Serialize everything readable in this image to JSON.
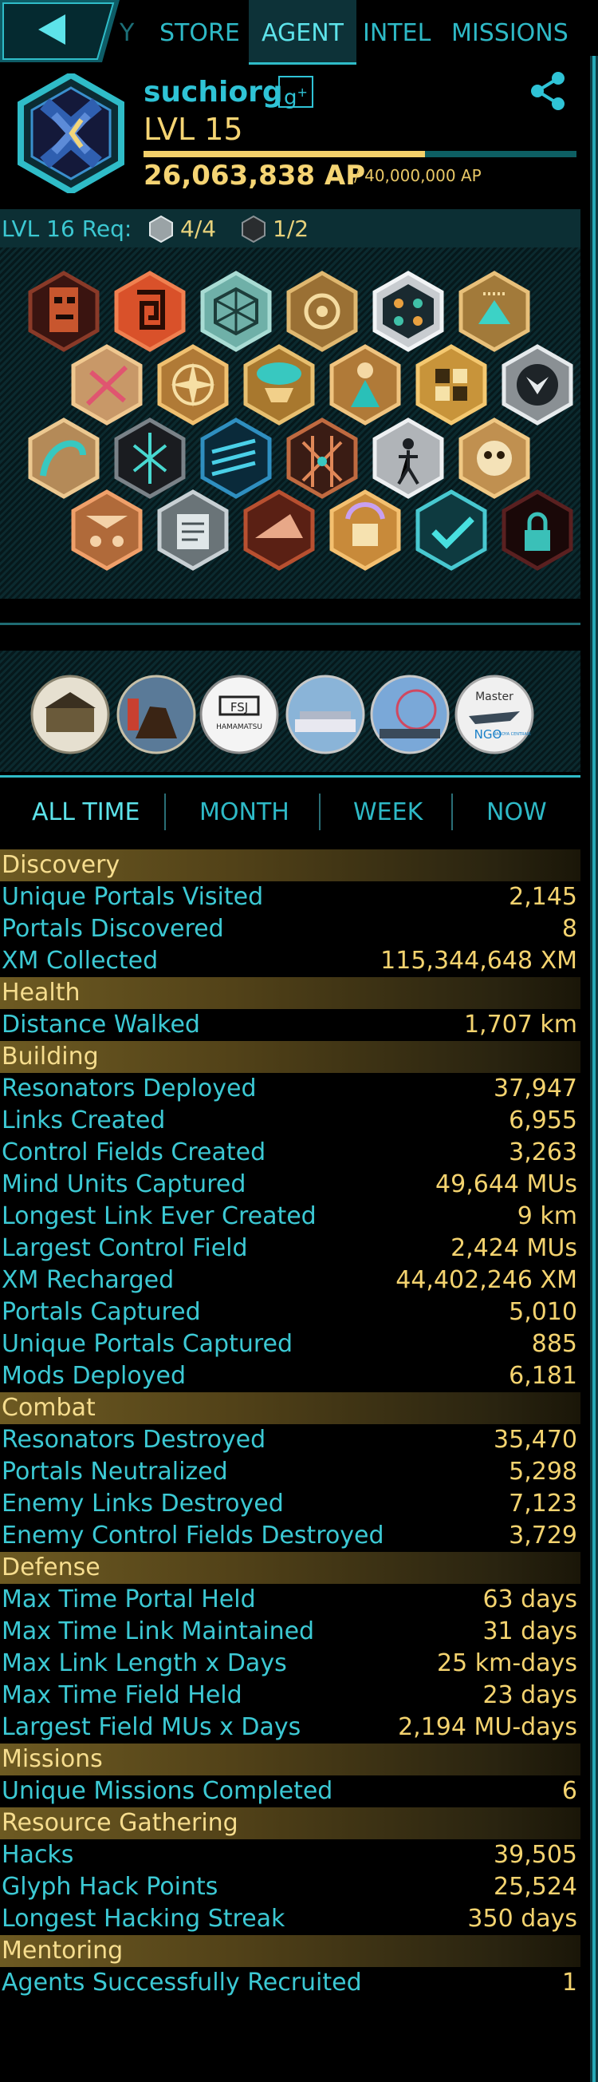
{
  "nav": {
    "tabs": [
      "Y",
      "STORE",
      "AGENT",
      "INTEL",
      "MISSIONS"
    ],
    "active_tab": "AGENT"
  },
  "profile": {
    "name": "suchiorg",
    "level": "LVL 15",
    "ap": "26,063,838 AP",
    "ap_max": "/ 40,000,000 AP",
    "level_progress": 0.65,
    "faction_color": "#2fc3d6"
  },
  "level_requirement": {
    "label": "LVL 16 Req:",
    "silver_count": "4/4",
    "dark_count": "1/2"
  },
  "badges": {
    "row1": [
      "badge-tiki",
      "badge-spiral",
      "badge-geodesic",
      "badge-hands",
      "badge-network",
      "badge-bloom"
    ],
    "row2": [
      "badge-thorns",
      "badge-compass",
      "badge-airship",
      "badge-lady",
      "badge-cubes",
      "badge-drop"
    ],
    "row3": [
      "badge-wave",
      "badge-scarab",
      "badge-wings",
      "badge-graph",
      "badge-walker",
      "badge-skull"
    ],
    "row4": [
      "badge-team",
      "badge-scroll",
      "badge-shark",
      "badge-fist",
      "badge-check",
      "badge-lock"
    ]
  },
  "mission_medals": [
    "medal-building",
    "medal-samurai",
    "medal-fsj",
    "medal-stadium",
    "medal-ferris",
    "medal-ngo"
  ],
  "medal_text": {
    "fsj": "FSJ",
    "fsj_sub": "HAMAMATSU",
    "master": "Master",
    "ngo": "NGO",
    "ngo_sub": "NAGOYA CENTRAIR"
  },
  "time_filter": {
    "options": [
      "ALL TIME",
      "MONTH",
      "WEEK",
      "NOW"
    ],
    "active": "ALL TIME"
  },
  "stats": [
    {
      "section": "Discovery",
      "rows": [
        {
          "label": "Unique Portals Visited",
          "value": "2,145"
        },
        {
          "label": "Portals Discovered",
          "value": "8"
        },
        {
          "label": "XM Collected",
          "value": "115,344,648 XM"
        }
      ]
    },
    {
      "section": "Health",
      "rows": [
        {
          "label": "Distance Walked",
          "value": "1,707 km"
        }
      ]
    },
    {
      "section": "Building",
      "rows": [
        {
          "label": "Resonators Deployed",
          "value": "37,947"
        },
        {
          "label": "Links Created",
          "value": "6,955"
        },
        {
          "label": "Control Fields Created",
          "value": "3,263"
        },
        {
          "label": "Mind Units Captured",
          "value": "49,644 MUs"
        },
        {
          "label": "Longest Link Ever Created",
          "value": "9 km"
        },
        {
          "label": "Largest Control Field",
          "value": "2,424 MUs"
        },
        {
          "label": "XM Recharged",
          "value": "44,402,246 XM"
        },
        {
          "label": "Portals Captured",
          "value": "5,010"
        },
        {
          "label": "Unique Portals Captured",
          "value": "885"
        },
        {
          "label": "Mods Deployed",
          "value": "6,181"
        }
      ]
    },
    {
      "section": "Combat",
      "rows": [
        {
          "label": "Resonators Destroyed",
          "value": "35,470"
        },
        {
          "label": "Portals Neutralized",
          "value": "5,298"
        },
        {
          "label": "Enemy Links Destroyed",
          "value": "7,123"
        },
        {
          "label": "Enemy Control Fields Destroyed",
          "value": "3,729"
        }
      ]
    },
    {
      "section": "Defense",
      "rows": [
        {
          "label": "Max Time Portal Held",
          "value": "63 days"
        },
        {
          "label": "Max Time Link Maintained",
          "value": "31 days"
        },
        {
          "label": "Max Link Length x Days",
          "value": "25 km-days"
        },
        {
          "label": "Max Time Field Held",
          "value": "23 days"
        },
        {
          "label": "Largest Field MUs x Days",
          "value": "2,194 MU-days"
        }
      ]
    },
    {
      "section": "Missions",
      "rows": [
        {
          "label": "Unique Missions Completed",
          "value": "6"
        }
      ]
    },
    {
      "section": "Resource Gathering",
      "rows": [
        {
          "label": "Hacks",
          "value": "39,505"
        },
        {
          "label": "Glyph Hack Points",
          "value": "25,524"
        },
        {
          "label": "Longest Hacking Streak",
          "value": "350 days"
        }
      ]
    },
    {
      "section": "Mentoring",
      "rows": [
        {
          "label": "Agents Successfully Recruited",
          "value": "1"
        }
      ]
    }
  ],
  "colors": {
    "accent": "#2fbcc8",
    "gold": "#f4d36f",
    "section_header": "#6d5a22"
  }
}
